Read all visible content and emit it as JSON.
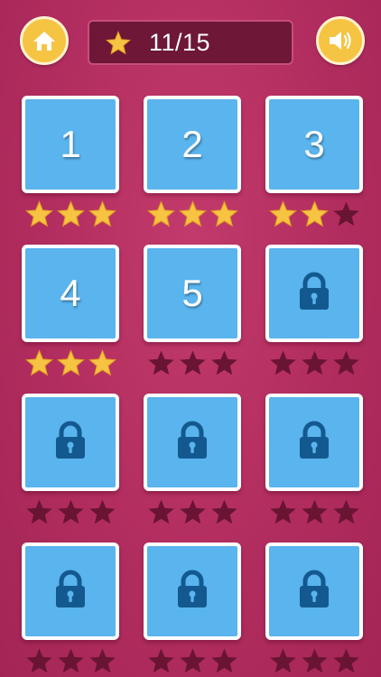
{
  "header": {
    "home_icon": "home-icon",
    "sound_icon": "speaker-icon",
    "score_icon": "star-icon",
    "score_text": "11/15"
  },
  "colors": {
    "background": "#b22d5f",
    "button": "#f5c443",
    "panel": "#6e1737",
    "tile": "#5ab4ee",
    "star_earned": "#f6c343",
    "star_empty": "#6a1433",
    "lock": "#13598f"
  },
  "levels": [
    {
      "label": "1",
      "locked": false,
      "stars": 3
    },
    {
      "label": "2",
      "locked": false,
      "stars": 3
    },
    {
      "label": "3",
      "locked": false,
      "stars": 2
    },
    {
      "label": "4",
      "locked": false,
      "stars": 3
    },
    {
      "label": "5",
      "locked": false,
      "stars": 0
    },
    {
      "label": "",
      "locked": true,
      "stars": 0
    },
    {
      "label": "",
      "locked": true,
      "stars": 0
    },
    {
      "label": "",
      "locked": true,
      "stars": 0
    },
    {
      "label": "",
      "locked": true,
      "stars": 0
    },
    {
      "label": "",
      "locked": true,
      "stars": 0
    },
    {
      "label": "",
      "locked": true,
      "stars": 0
    },
    {
      "label": "",
      "locked": true,
      "stars": 0
    }
  ]
}
